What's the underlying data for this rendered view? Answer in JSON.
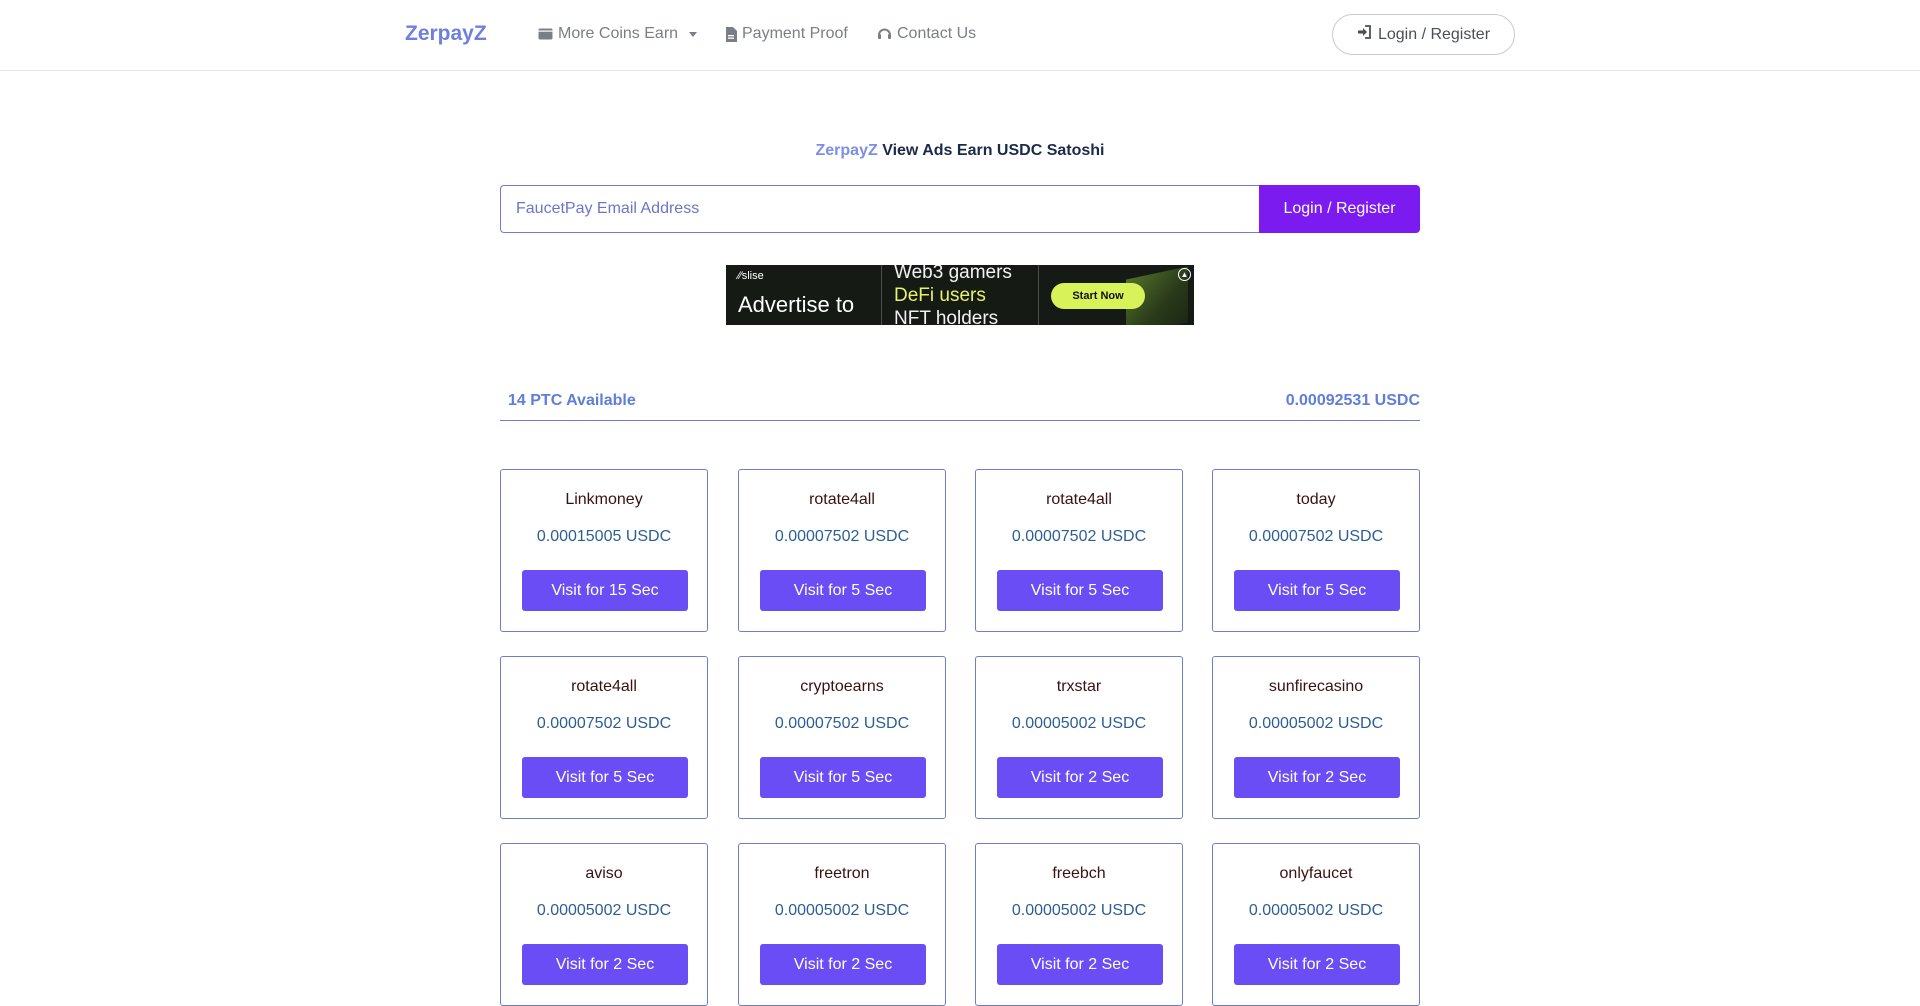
{
  "nav": {
    "brand": "ZerpayZ",
    "items": [
      {
        "label": "More Coins Earn",
        "icon": "wallet-icon"
      },
      {
        "label": "Payment Proof",
        "icon": "file-icon"
      },
      {
        "label": "Contact Us",
        "icon": "headset-icon"
      }
    ],
    "login_label": "Login / Register",
    "login_icon": "sign-in-icon"
  },
  "hero": {
    "brand": "ZerpayZ",
    "title": "View Ads Earn USDC Satoshi",
    "email_placeholder": "FaucetPay Email Address",
    "login_button": "Login / Register"
  },
  "ad": {
    "logo": "slise",
    "headline": "Advertise to",
    "lines": [
      "Web3 gamers",
      "DeFi users",
      "NFT holders"
    ],
    "cta": "Start Now"
  },
  "stats": {
    "ptc_available": "14 PTC Available",
    "total": "0.00092531 USDC"
  },
  "cards": [
    {
      "name": "Linkmoney",
      "reward": "0.00015005 USDC",
      "button": "Visit for 15 Sec"
    },
    {
      "name": "rotate4all",
      "reward": "0.00007502 USDC",
      "button": "Visit for 5 Sec"
    },
    {
      "name": "rotate4all",
      "reward": "0.00007502 USDC",
      "button": "Visit for 5 Sec"
    },
    {
      "name": "today",
      "reward": "0.00007502 USDC",
      "button": "Visit for 5 Sec"
    },
    {
      "name": "rotate4all",
      "reward": "0.00007502 USDC",
      "button": "Visit for 5 Sec"
    },
    {
      "name": "cryptoearns",
      "reward": "0.00007502 USDC",
      "button": "Visit for 5 Sec"
    },
    {
      "name": "trxstar",
      "reward": "0.00005002 USDC",
      "button": "Visit for 2 Sec"
    },
    {
      "name": "sunfirecasino",
      "reward": "0.00005002 USDC",
      "button": "Visit for 2 Sec"
    },
    {
      "name": "aviso",
      "reward": "0.00005002 USDC",
      "button": "Visit for 2 Sec"
    },
    {
      "name": "freetron",
      "reward": "0.00005002 USDC",
      "button": "Visit for 2 Sec"
    },
    {
      "name": "freebch",
      "reward": "0.00005002 USDC",
      "button": "Visit for 2 Sec"
    },
    {
      "name": "onlyfaucet",
      "reward": "0.00005002 USDC",
      "button": "Visit for 2 Sec"
    }
  ],
  "colors": {
    "brand": "#6f7fe0",
    "primary_button": "#7b1bf0",
    "card_button": "#6a4df5",
    "card_border": "#6f7fc6"
  }
}
